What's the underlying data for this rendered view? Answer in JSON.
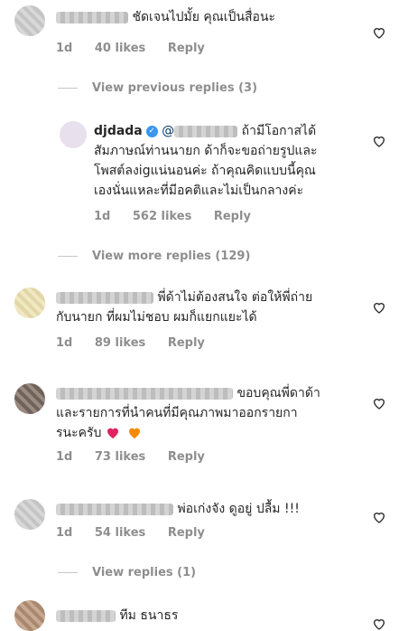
{
  "comments": [
    {
      "text": "ชัดเจนไปมั้ย คุณเป็นสื่อนะ",
      "time": "1d",
      "likes": "40 likes",
      "reply": "Reply"
    },
    {
      "username": "djdada",
      "mention": "@",
      "lines": [
        "ถ้ามีโอกาสได้",
        "สัมภาษณ์ท่านนายก ด้าก็จะขอถ่ายรูปและ",
        "โพสต์ลงigแน่นอนค่ะ ถ้าคุณคิดแบบนี้คุณ",
        "เองนั่นแหละที่มีอคติและไม่เป็นกลางค่ะ"
      ],
      "time": "1d",
      "likes": "562 likes",
      "reply": "Reply"
    },
    {
      "lines": [
        "พี่ด้าไม่ต้องสนใจ ต่อให้พี่ถ่าย",
        "กับนายก ที่ผมไม่ชอบ ผมก็แยกแยะได้"
      ],
      "time": "1d",
      "likes": "89 likes",
      "reply": "Reply"
    },
    {
      "lines": [
        "ขอบคุณพี่ดาด้า",
        "และรายการที่นำคนที่มีคุณภาพมาออกรายกา",
        "รนะครับ"
      ],
      "time": "1d",
      "likes": "73 likes",
      "reply": "Reply"
    },
    {
      "text": "พ่อเก่งจัง ดูอยู่ ปลื้ม !!!",
      "time": "1d",
      "likes": "54 likes",
      "reply": "Reply"
    },
    {
      "text": "ทีม ธนาธร"
    }
  ],
  "view_prev": "View previous replies (3)",
  "view_more": "View more replies (129)",
  "view_replies": "View replies (1)",
  "colors": {
    "heart_red": "#e0245e",
    "heart_orange": "#f58a07",
    "verified": "#3897f0"
  },
  "icons": {
    "like": "heart-outline-icon",
    "verified": "verified-badge-icon"
  }
}
